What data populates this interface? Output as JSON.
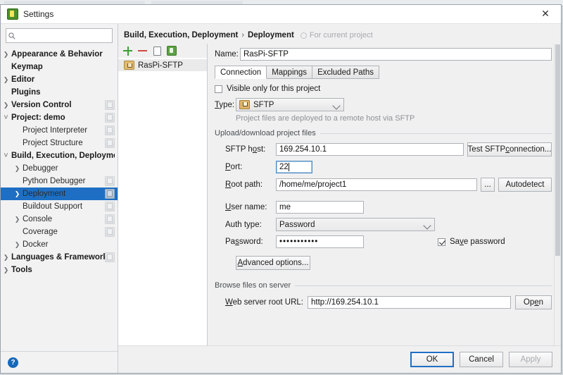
{
  "window": {
    "title": "Settings",
    "close_icon": "close-icon"
  },
  "sidebar": {
    "search": {
      "value": "",
      "placeholder": ""
    },
    "items": [
      {
        "label": "Appearance & Behavior",
        "arrow": "›",
        "bold": true,
        "indent": 0,
        "config_icon": false,
        "selected": false
      },
      {
        "label": "Keymap",
        "arrow": "",
        "bold": true,
        "indent": 0,
        "config_icon": false,
        "selected": false
      },
      {
        "label": "Editor",
        "arrow": "›",
        "bold": true,
        "indent": 0,
        "config_icon": false,
        "selected": false
      },
      {
        "label": "Plugins",
        "arrow": "",
        "bold": true,
        "indent": 0,
        "config_icon": false,
        "selected": false
      },
      {
        "label": "Version Control",
        "arrow": "›",
        "bold": true,
        "indent": 0,
        "config_icon": true,
        "selected": false
      },
      {
        "label": "Project: demo",
        "arrow": "⌄",
        "bold": true,
        "indent": 0,
        "config_icon": true,
        "selected": false
      },
      {
        "label": "Project Interpreter",
        "arrow": "",
        "bold": false,
        "indent": 1,
        "config_icon": true,
        "selected": false
      },
      {
        "label": "Project Structure",
        "arrow": "",
        "bold": false,
        "indent": 1,
        "config_icon": true,
        "selected": false
      },
      {
        "label": "Build, Execution, Deployment",
        "arrow": "⌄",
        "bold": true,
        "indent": 0,
        "config_icon": false,
        "selected": false
      },
      {
        "label": "Debugger",
        "arrow": "›",
        "bold": false,
        "indent": 1,
        "config_icon": false,
        "selected": false
      },
      {
        "label": "Python Debugger",
        "arrow": "",
        "bold": false,
        "indent": 1,
        "config_icon": true,
        "selected": false
      },
      {
        "label": "Deployment",
        "arrow": "›",
        "bold": false,
        "indent": 1,
        "config_icon": true,
        "selected": true
      },
      {
        "label": "Buildout Support",
        "arrow": "",
        "bold": false,
        "indent": 1,
        "config_icon": true,
        "selected": false
      },
      {
        "label": "Console",
        "arrow": "›",
        "bold": false,
        "indent": 1,
        "config_icon": true,
        "selected": false
      },
      {
        "label": "Coverage",
        "arrow": "",
        "bold": false,
        "indent": 1,
        "config_icon": true,
        "selected": false
      },
      {
        "label": "Docker",
        "arrow": "›",
        "bold": false,
        "indent": 1,
        "config_icon": false,
        "selected": false
      },
      {
        "label": "Languages & Frameworks",
        "arrow": "›",
        "bold": true,
        "indent": 0,
        "config_icon": true,
        "selected": false
      },
      {
        "label": "Tools",
        "arrow": "›",
        "bold": true,
        "indent": 0,
        "config_icon": false,
        "selected": false
      }
    ],
    "help_label": "?"
  },
  "breadcrumb": {
    "root": "Build, Execution, Deployment",
    "separator": "›",
    "leaf": "Deployment",
    "scope_note": "For current project"
  },
  "server_list": {
    "toolbar": [
      {
        "name": "add-server-button",
        "label": "+"
      },
      {
        "name": "remove-server-button",
        "label": "−"
      },
      {
        "name": "copy-server-button",
        "label": ""
      },
      {
        "name": "toggle-visible-button",
        "label": ""
      }
    ],
    "items": [
      {
        "label": "RasPi-SFTP"
      }
    ]
  },
  "form": {
    "name_label": "Name:",
    "name_value": "RasPi-SFTP",
    "tabs": [
      {
        "label": "Connection",
        "active": true
      },
      {
        "label": "Mappings",
        "active": false
      },
      {
        "label": "Excluded Paths",
        "active": false
      }
    ],
    "visible_only_label": "Visible only for this project",
    "visible_only_checked": false,
    "type_label": "Type:",
    "type_value": "SFTP",
    "type_hint": "Project files are deployed to a remote host via SFTP",
    "upload_group_label": "Upload/download project files",
    "sftp_host_label": "SFTP host:",
    "sftp_host_value": "169.254.10.1",
    "test_connection_label": "Test SFTP connection...",
    "port_label": "Port:",
    "port_value": "22",
    "root_path_label": "Root path:",
    "root_path_value": "/home/me/project1",
    "browse_ellipsis_label": "...",
    "autodetect_label": "Autodetect",
    "user_name_label": "User name:",
    "user_name_value": "me",
    "auth_type_label": "Auth type:",
    "auth_type_value": "Password",
    "password_label": "Password:",
    "password_value": "•••••••••••",
    "save_password_label": "Save password",
    "save_password_checked": true,
    "advanced_options_label": "Advanced options...",
    "browse_group_label": "Browse files on server",
    "web_root_label": "Web server root URL:",
    "web_root_value": "http://169.254.10.1",
    "open_label": "Open"
  },
  "footer": {
    "ok_label": "OK",
    "cancel_label": "Cancel",
    "apply_label": "Apply",
    "apply_enabled": false
  },
  "colors": {
    "selection_blue": "#1e6fc4",
    "accent_green": "#3f9e35",
    "accent_red": "#d24a43",
    "help_blue": "#1668b8",
    "folder_gold": "#e2b971"
  }
}
